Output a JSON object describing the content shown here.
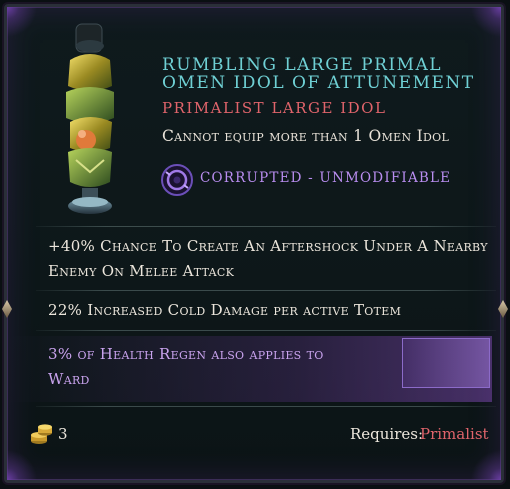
{
  "item": {
    "title": "Rumbling Large Primal Omen Idol of Attunement",
    "type_label": "Primalist Large Idol",
    "restriction": "Cannot equip more than 1 Omen Idol",
    "corrupted_label": "Corrupted - Unmodifiable",
    "mods": [
      "+40% Chance To Create An Aftershock Under A Nearby Enemy On Melee Attack",
      "22% Increased Cold Damage per active Totem",
      "3% of Health Regen also applies to Ward"
    ],
    "icons": {
      "idol": "idol-icon",
      "corrupted": "corrupted-eye-icon",
      "currency": "gold-coins-icon"
    }
  },
  "footer": {
    "count": "3",
    "requires_label": "Requires:",
    "requires_value": "Primalist"
  },
  "colors": {
    "title": "#6fd0d4",
    "type": "#e0646b",
    "corrupted": "#b98df0",
    "sealed_mod": "#c9a3ee",
    "requires_value": "#e0646b"
  }
}
